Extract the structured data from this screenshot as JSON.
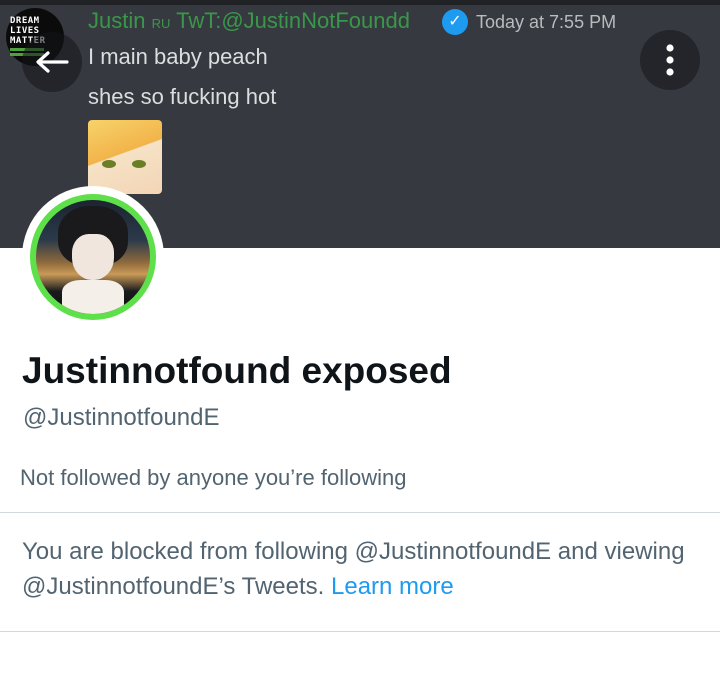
{
  "banner": {
    "badge_lines": [
      "DREAM",
      "LIVES",
      "MATTER"
    ],
    "message": {
      "author": "Justin",
      "author_tag": "RU",
      "author_rest": "TwT:@JustinNotFoundd",
      "timestamp": "Today at 7:55 PM",
      "lines": [
        "I main baby peach",
        "shes so fucking hot"
      ]
    }
  },
  "header": {
    "back_icon": "arrow-left-icon",
    "more_icon": "more-vertical-icon"
  },
  "profile": {
    "display_name": "Justinnotfound exposed",
    "handle": "@JustinnotfoundE",
    "followers_note": "Not followed by anyone you’re following",
    "blocked_text": "You are blocked from following @JustinnotfoundE and viewing @JustinnotfoundE’s Tweets.",
    "learn_more": "Learn more"
  },
  "colors": {
    "accent": "#1d9bf0",
    "text_primary": "#0f1419",
    "text_secondary": "#536471",
    "divider": "#cfd9de",
    "banner_bg": "#36393f"
  }
}
